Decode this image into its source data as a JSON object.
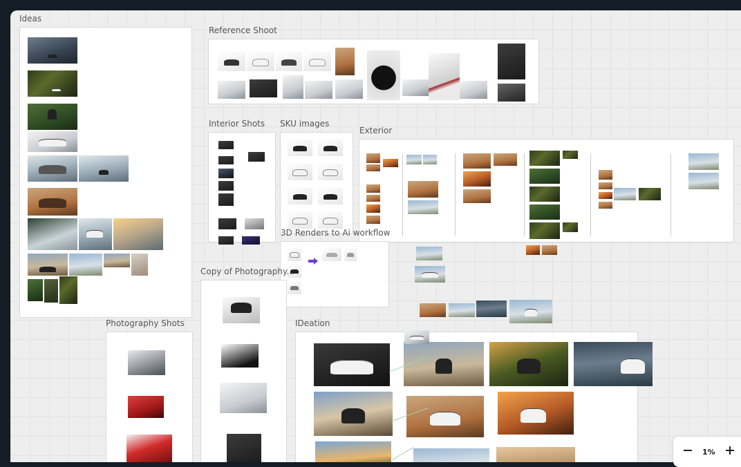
{
  "frames": {
    "ideas": "Ideas",
    "reference_shoot": "Reference Shoot",
    "interior_shots": "Interior Shots",
    "sku_images": "SKU images",
    "exterior": "Exterior",
    "renders_workflow": "3D Renders to Ai workflow",
    "copy_photography": "Copy of Photography...",
    "photography_shots": "Photography Shots",
    "ideation": "IDeation"
  },
  "zoom": {
    "level": "1%",
    "zoom_out_icon": "minus-icon",
    "zoom_in_icon": "plus-icon"
  },
  "colors": {
    "background": "#141d26",
    "canvas": "#eeeeee",
    "frame": "#ffffff",
    "arrow_accent": "#6a3fd3"
  }
}
